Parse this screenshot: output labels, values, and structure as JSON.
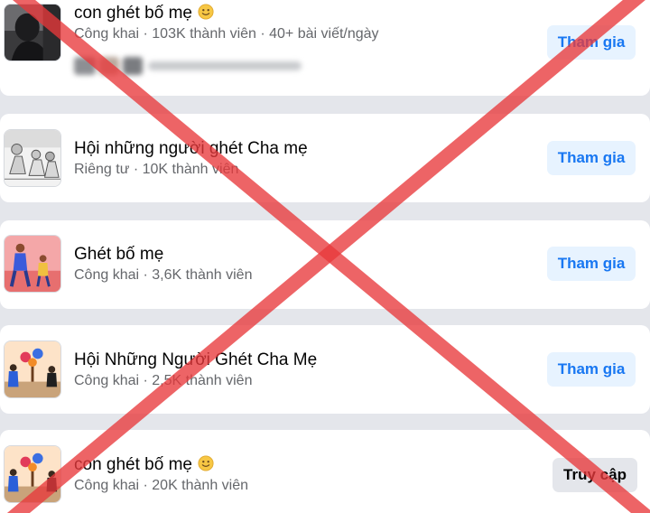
{
  "groups": [
    {
      "name": "con ghét bố mẹ",
      "emoji": "slightly-smiling-face-emoji",
      "meta": "Công khai · 103K thành viên · 40+ bài viết/ngày",
      "action": "Tham gia",
      "thumbnail": "dark-portrait-thumbnail"
    },
    {
      "name": "Hội những người ghét Cha mẹ",
      "meta": "Riêng tư · 10K thành viên",
      "action": "Tham gia",
      "thumbnail": "comic-sketch-thumbnail"
    },
    {
      "name": "Ghét bố mẹ",
      "meta": "Công khai · 3,6K thành viên",
      "action": "Tham gia",
      "thumbnail": "parent-child-illustration-thumbnail"
    },
    {
      "name": "Hội Những Người Ghét Cha Mẹ",
      "meta": "Công khai · 2,5K thành viên",
      "action": "Tham gia",
      "thumbnail": "people-watering-tree-thumbnail"
    },
    {
      "name": "con ghét bố mẹ",
      "emoji": "slightly-smiling-face-emoji",
      "meta": "Công khai · 20K thành viên",
      "action": "Truy cập",
      "thumbnail": "people-watering-tree-thumbnail"
    }
  ],
  "colors": {
    "join_button_bg": "#e7f3ff",
    "join_button_text": "#1877f2",
    "visit_button_bg": "#e4e6eb",
    "overlay_cross": "#e8393b"
  }
}
